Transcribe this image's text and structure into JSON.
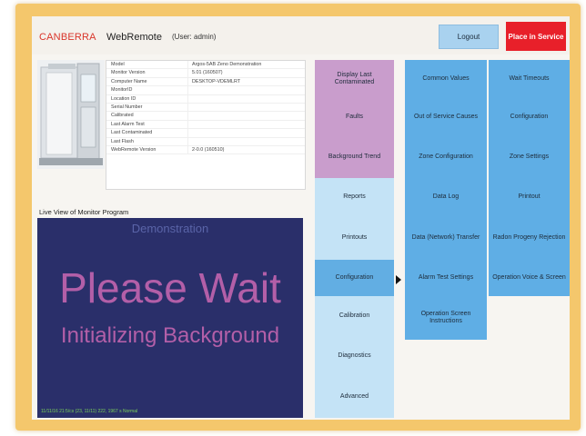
{
  "header": {
    "brand": "CANBERRA",
    "app_name": "WebRemote",
    "user": "(User: admin)",
    "logout_label": "Logout",
    "place_service_label": "Place in Service"
  },
  "info_rows": [
    {
      "key": "Model",
      "value": "Argos-5AB Zeno Demonstration"
    },
    {
      "key": "Monitor Version",
      "value": "5.01 (160507)"
    },
    {
      "key": "Computer Name",
      "value": "DESKTOP-VDEMLRT"
    },
    {
      "key": "MonitorID",
      "value": ""
    },
    {
      "key": "Location ID",
      "value": ""
    },
    {
      "key": "Serial Number",
      "value": ""
    },
    {
      "key": "Calibrated",
      "value": ""
    },
    {
      "key": "Last Alarm Test",
      "value": ""
    },
    {
      "key": "Last Contaminated",
      "value": ""
    },
    {
      "key": "Last Flash",
      "value": ""
    },
    {
      "key": "WebRemote Version",
      "value": "2-0.0 (160510)"
    }
  ],
  "live": {
    "label": "Live View of Monitor Program",
    "demo": "Demonstration",
    "wait": "Please Wait",
    "init": "Initializing Background",
    "status": "11/11/16 21:5/cs (23, 11/11) 222, 1967 s  Normal"
  },
  "menu_col1": [
    "Display Last Contaminated",
    "Faults",
    "Background Trend",
    "Reports",
    "Printouts",
    "Configuration",
    "Calibration",
    "Diagnostics",
    "Advanced"
  ],
  "menu_col2": [
    "Common Values",
    "Out of Service Causes",
    "Zone Configuration",
    "Data Log",
    "Data (Network) Transfer",
    "Alarm Test Settings",
    "Operation Screen Instructions"
  ],
  "menu_col3": [
    "Wait Timeouts",
    "Configuration",
    "Zone Settings",
    "Printout",
    "Radon Progeny Rejection",
    "Operation Voice & Screen"
  ],
  "colors": {
    "frame": "#f4c76c",
    "service": "#e8202a",
    "pink": "#c99dcc",
    "active": "#62aee3",
    "live_bg": "#2a2f6a",
    "live_text": "#b35fa8"
  }
}
